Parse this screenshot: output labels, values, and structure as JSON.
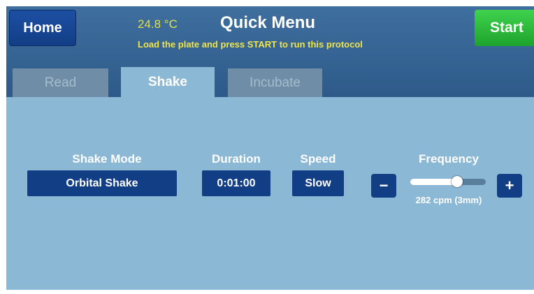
{
  "header": {
    "home_label": "Home",
    "temperature": "24.8 °C",
    "title": "Quick Menu",
    "subtitle": "Load the plate and press START to run this protocol",
    "start_label": "Start"
  },
  "tabs": [
    {
      "label": "Read",
      "active": false
    },
    {
      "label": "Shake",
      "active": true
    },
    {
      "label": "Incubate",
      "active": false
    }
  ],
  "shake": {
    "mode_label": "Shake Mode",
    "mode_value": "Orbital Shake",
    "duration_label": "Duration",
    "duration_value": "0:01:00",
    "speed_label": "Speed",
    "speed_value": "Slow",
    "frequency_label": "Frequency",
    "frequency_minus": "−",
    "frequency_plus": "+",
    "frequency_value": "282 cpm (3mm)",
    "frequency_slider_fraction": 0.62
  },
  "colors": {
    "header_bg": "#2d5a89",
    "panel_bg": "#8ab8d5",
    "button_blue": "#123e86",
    "start_green": "#2bbf3a",
    "subtitle_yellow": "#f0e44c"
  }
}
